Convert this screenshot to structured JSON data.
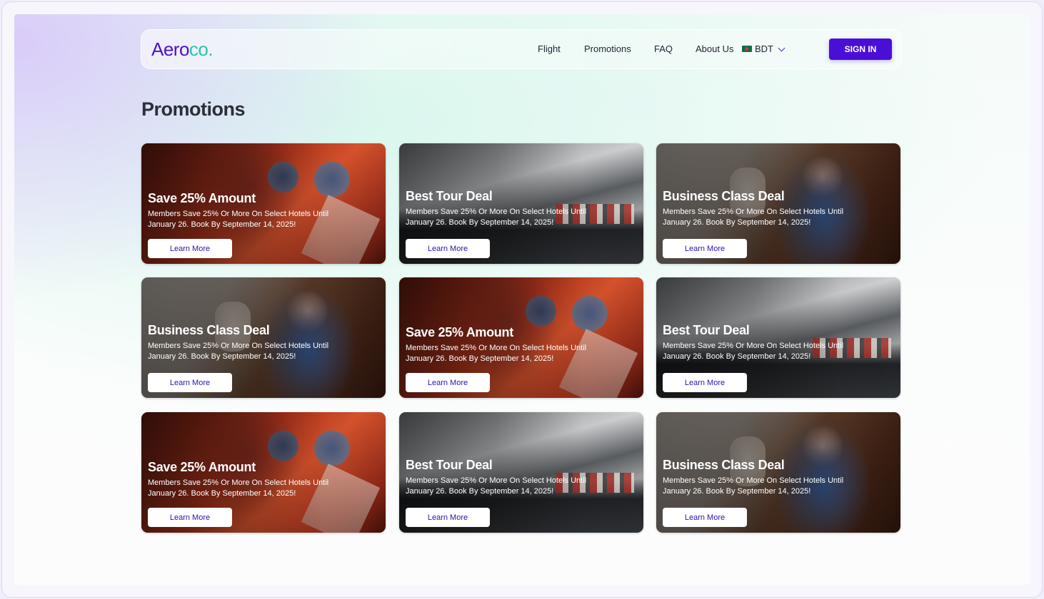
{
  "brand": {
    "name_part1": "Aero",
    "name_part2": "co."
  },
  "nav": {
    "links": [
      "Flight",
      "Promotions",
      "FAQ",
      "About Us"
    ],
    "currency": "BDT",
    "signin_label": "SIGN IN"
  },
  "page_title": "Promotions",
  "cards": [
    {
      "theme": "red",
      "title": "Save 25% Amount",
      "description": "Members Save 25% Or More On Select Hotels Until January 26. Book By September 14, 2025!",
      "button": "Learn More"
    },
    {
      "theme": "mtn",
      "title": "Best Tour Deal",
      "description": "Members Save 25% Or More On Select Hotels Until January 26. Book By September 14, 2025!",
      "button": "Learn More"
    },
    {
      "theme": "biz",
      "title": "Business Class Deal",
      "description": "Members Save 25% Or More On Select Hotels Until January 26. Book By September 14, 2025!",
      "button": "Learn More"
    },
    {
      "theme": "biz",
      "title": "Business Class Deal",
      "description": "Members Save 25% Or More On Select Hotels Until January 26. Book By September 14, 2025!",
      "button": "Learn More"
    },
    {
      "theme": "red",
      "title": "Save 25% Amount",
      "description": "Members Save 25% Or More On Select Hotels Until January 26. Book By September 14, 2025!",
      "button": "Learn More"
    },
    {
      "theme": "mtn",
      "title": "Best Tour Deal",
      "description": "Members Save 25% Or More On Select Hotels Until January 26. Book By September 14, 2025!",
      "button": "Learn More"
    },
    {
      "theme": "red",
      "title": "Save 25% Amount",
      "description": "Members Save 25% Or More On Select Hotels Until January 26. Book By September 14, 2025!",
      "button": "Learn More"
    },
    {
      "theme": "mtn",
      "title": "Best Tour Deal",
      "description": "Members Save 25% Or More On Select Hotels Until January 26. Book By September 14, 2025!",
      "button": "Learn More"
    },
    {
      "theme": "biz",
      "title": "Business Class Deal",
      "description": "Members Save 25% Or More On Select Hotels Until January 26. Book By September 14, 2025!",
      "button": "Learn More"
    }
  ],
  "colors": {
    "primary": "#4a0fd6",
    "accent": "#28c7a7",
    "text_dark": "#2b2f38"
  }
}
